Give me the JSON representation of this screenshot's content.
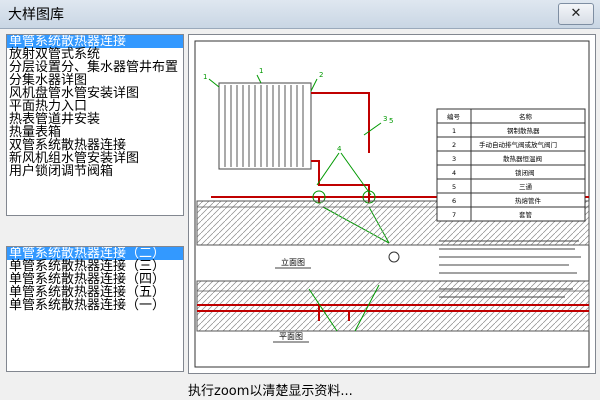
{
  "window": {
    "title": "大样图库",
    "close_glyph": "✕"
  },
  "category_list": {
    "items": [
      "单管系统散热器连接",
      "放射双管式系统",
      "分层设置分、集水器管井布置",
      "分集水器详图",
      "风机盘管水管安装详图",
      "平面热力入口",
      "热表管道井安装",
      "热量表箱",
      "双管系统散热器连接",
      "新风机组水管安装详图",
      "用户锁闭调节阀箱"
    ],
    "selected_index": 0
  },
  "drawing_list": {
    "items": [
      "单管系统散热器连接（二）",
      "单管系统散热器连接（三）",
      "单管系统散热器连接（四）",
      "单管系统散热器连接（五）",
      "单管系统散热器连接（一）"
    ],
    "selected_index": 0
  },
  "status_text": "执行zoom以清楚显示资料...",
  "drawing": {
    "elevation_label": "立面图",
    "plan_label": "平面图",
    "legend_header": [
      "编号",
      "名称"
    ],
    "legend_rows": [
      [
        "1",
        "钢制散热器"
      ],
      [
        "2",
        "手动自动排气阀或放气阀门"
      ],
      [
        "3",
        "散热器恒温阀"
      ],
      [
        "4",
        "锁闭阀"
      ],
      [
        "5",
        "三通"
      ],
      [
        "6",
        "热熔管件"
      ],
      [
        "7",
        "套管"
      ]
    ],
    "colors": {
      "pipe_red": "#c00000",
      "leader_green": "#009900",
      "hatch": "#6a6a6a"
    }
  }
}
